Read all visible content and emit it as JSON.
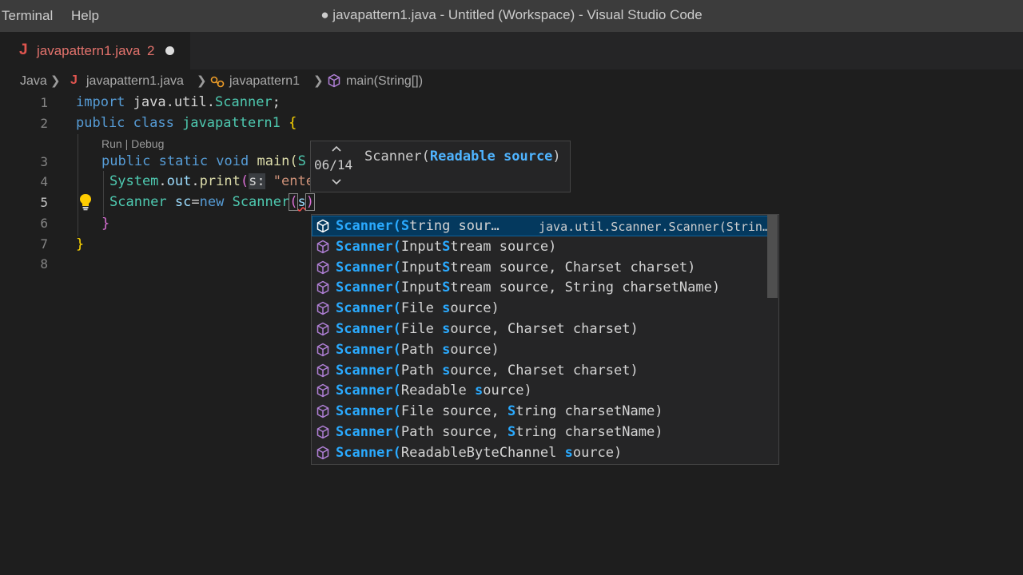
{
  "window": {
    "title": "● javapattern1.java - Untitled (Workspace) - Visual Studio Code",
    "menu": [
      "Terminal",
      "Help"
    ]
  },
  "tab": {
    "icon_letter": "J",
    "filename": "javapattern1.java",
    "error_count": "2"
  },
  "breadcrumb": {
    "items": [
      "Java",
      "javapattern1.java",
      "javapattern1",
      "main(String[])"
    ]
  },
  "editor": {
    "line_numbers": [
      "1",
      "2",
      "3",
      "4",
      "5",
      "6",
      "7",
      "8"
    ],
    "codelens": "Run | Debug",
    "lines": {
      "l1_import": "import",
      "l1_path": " java.util.",
      "l1_cls": "Scanner",
      "l1_semi": ";",
      "l2_kw": "public class",
      "l2_cls": " javapattern1 ",
      "l2_brace": "{",
      "l3_kw": "public static void",
      "l3_fn": " main(",
      "l3_rest": "S",
      "l4_sys": "System",
      "l4_dot1": ".",
      "l4_out": "out",
      "l4_dot2": ".",
      "l4_fn": "print",
      "l4_paren": "(",
      "l4_hint": "s:",
      "l4_str": " \"ente",
      "l5_cls": "Scanner",
      "l5_var": " sc",
      "l5_eq": "=",
      "l5_new": "new",
      "l5_cls2": " Scanner",
      "l5_paren": "(",
      "l5_arg": "s",
      "l5_close": ")",
      "l6_brace": "}",
      "l7_brace": "}"
    }
  },
  "parameter_hint": {
    "counter": "06/14",
    "signature_pre": "Scanner(",
    "signature_param": "Readable source",
    "signature_post": ")"
  },
  "suggestions": {
    "detail": "java.util.Scanner.Scanner(Strin…",
    "items": [
      {
        "head": "Scanner(",
        "pre": "",
        "hl": "S",
        "post": "tring sour…"
      },
      {
        "head": "Scanner(",
        "pre": "Input",
        "hl": "S",
        "post": "tream source)"
      },
      {
        "head": "Scanner(",
        "pre": "Input",
        "hl": "S",
        "post": "tream source, Charset charset)"
      },
      {
        "head": "Scanner(",
        "pre": "Input",
        "hl": "S",
        "post": "tream source, String charsetName)"
      },
      {
        "head": "Scanner(",
        "pre": "File ",
        "hl": "s",
        "post": "ource)"
      },
      {
        "head": "Scanner(",
        "pre": "File ",
        "hl": "s",
        "post": "ource, Charset charset)"
      },
      {
        "head": "Scanner(",
        "pre": "Path ",
        "hl": "s",
        "post": "ource)"
      },
      {
        "head": "Scanner(",
        "pre": "Path ",
        "hl": "s",
        "post": "ource, Charset charset)"
      },
      {
        "head": "Scanner(",
        "pre": "Readable ",
        "hl": "s",
        "post": "ource)"
      },
      {
        "head": "Scanner(",
        "pre": "File source, ",
        "hl": "S",
        "post": "tring charsetName)"
      },
      {
        "head": "Scanner(",
        "pre": "Path source, ",
        "hl": "S",
        "post": "tring charsetName)"
      },
      {
        "head": "Scanner(",
        "pre": "ReadableByteChannel ",
        "hl": "s",
        "post": "ource)"
      }
    ]
  },
  "colors": {
    "selected_row": "#04395e",
    "match_highlight": "#2aaaff",
    "error": "#e0554f",
    "method_icon": "#b180d7"
  }
}
